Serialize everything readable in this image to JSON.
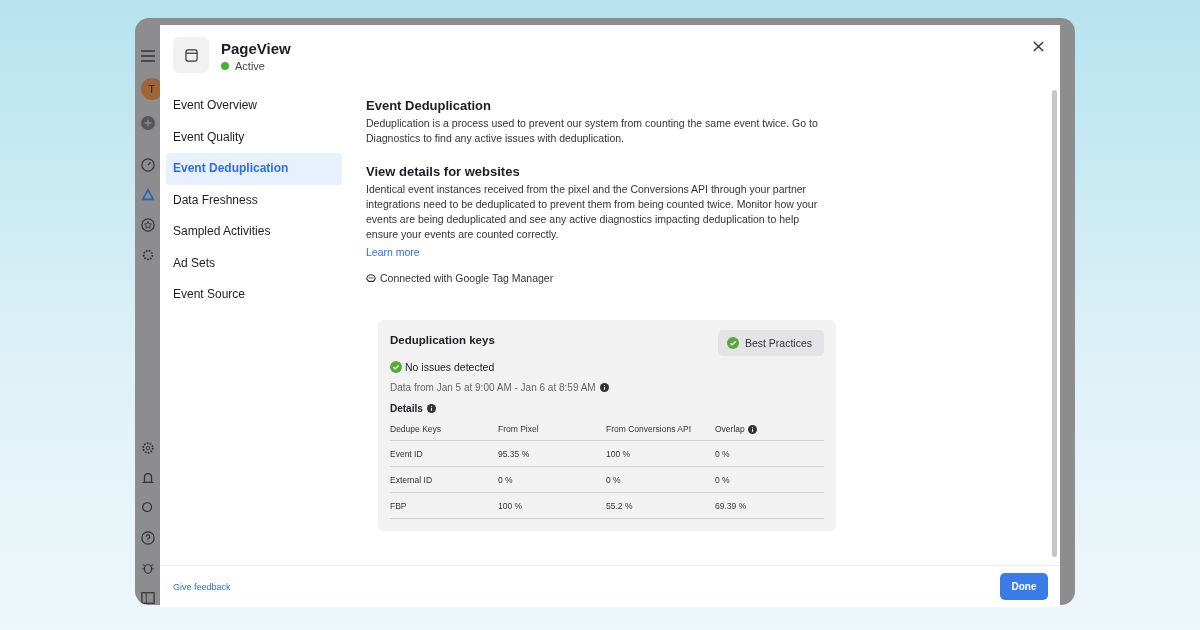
{
  "background": {
    "avatar_letter": "T"
  },
  "dialog": {
    "title": "PageView",
    "status": "Active"
  },
  "nav": [
    {
      "label": "Event Overview",
      "selected": false
    },
    {
      "label": "Event Quality",
      "selected": false
    },
    {
      "label": "Event Deduplication",
      "selected": true
    },
    {
      "label": "Data Freshness",
      "selected": false
    },
    {
      "label": "Sampled Activities",
      "selected": false
    },
    {
      "label": "Ad Sets",
      "selected": false
    },
    {
      "label": "Event Source",
      "selected": false
    }
  ],
  "sections": [
    {
      "heading": "Event Deduplication",
      "text": "Deduplication is a process used to prevent our system from counting the same event twice. Go to Diagnostics to find any active issues with deduplication."
    },
    {
      "heading": "View details for websites",
      "text": "Identical event instances received from the pixel and the Conversions API through your partner integrations need to be deduplicated to prevent them from being counted twice. Monitor how your events are being deduplicated and see any active diagnostics impacting deduplication to help ensure your events are counted correctly.",
      "link": "Learn more"
    }
  ],
  "connection": "Connected with Google Tag Manager",
  "card": {
    "title": "Deduplication keys",
    "button": "Best Practices",
    "status": "No issues detected",
    "date_range": "Data from Jan 5 at 9:00 AM - Jan 6 at 8:59 AM",
    "details_label": "Details",
    "columns": [
      "Dedupe Keys",
      "From Pixel",
      "From Conversions API",
      "Overlap"
    ],
    "rows": [
      [
        "Event ID",
        "95.35 %",
        "100 %",
        "0 %"
      ],
      [
        "External ID",
        "0 %",
        "0 %",
        "0 %"
      ],
      [
        "FBP",
        "100 %",
        "55.2 %",
        "69.39 %"
      ]
    ]
  },
  "footer": {
    "link": "Give feedback",
    "button": "Done"
  }
}
